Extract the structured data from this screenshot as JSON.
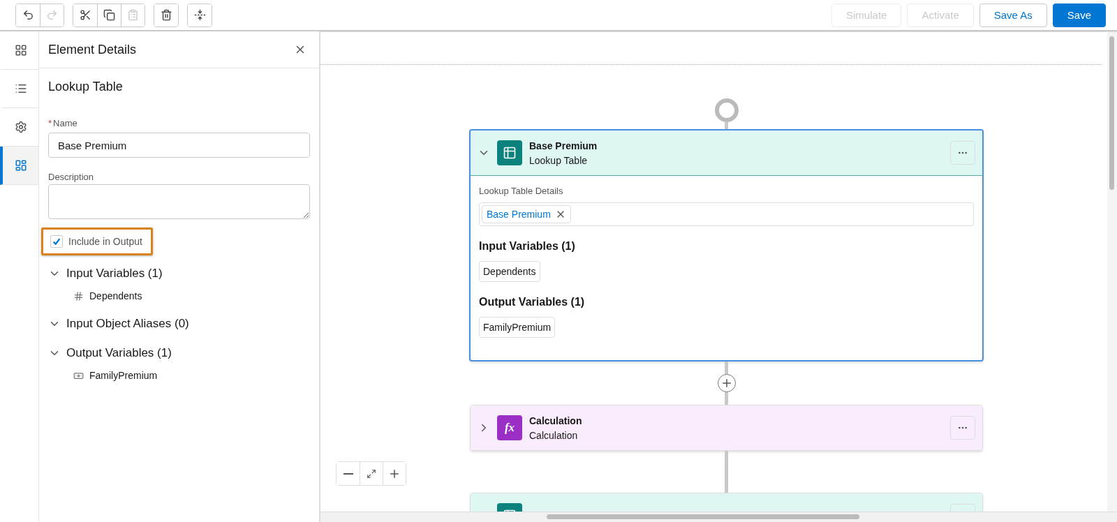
{
  "toolbar": {
    "groups": [
      [
        {
          "kind": "undo",
          "disabled": false
        },
        {
          "kind": "redo",
          "disabled": true
        }
      ],
      [
        {
          "kind": "cut",
          "disabled": false
        },
        {
          "kind": "copy",
          "disabled": false
        },
        {
          "kind": "paste",
          "disabled": true
        }
      ],
      [
        {
          "kind": "delete",
          "disabled": false
        }
      ],
      [
        {
          "kind": "insert",
          "disabled": false
        }
      ]
    ],
    "actions": [
      {
        "label": "Simulate",
        "kind": "neutral",
        "disabled": true
      },
      {
        "label": "Activate",
        "kind": "neutral",
        "disabled": true
      },
      {
        "label": "Save As",
        "kind": "neutral",
        "disabled": false
      },
      {
        "label": "Save",
        "kind": "primary",
        "disabled": false
      }
    ]
  },
  "rail": [
    {
      "kind": "components",
      "selected": false
    },
    {
      "kind": "list",
      "selected": false
    },
    {
      "kind": "settings",
      "selected": false
    },
    {
      "kind": "details",
      "selected": true
    }
  ],
  "panel": {
    "title": "Element Details",
    "heading": "Lookup Table",
    "name_field": {
      "required_mark": "*",
      "label": "Name",
      "value": "Base Premium"
    },
    "description_field": {
      "label": "Description"
    },
    "include_output": {
      "label": "Include in Output",
      "checked": true,
      "highlighted": true
    },
    "sections": [
      {
        "title": "Input Variables (1)",
        "expanded": true,
        "items": [
          {
            "kind": "number",
            "label": "Dependents"
          }
        ]
      },
      {
        "title": "Input Object Aliases (0)",
        "expanded": true
      },
      {
        "title": "Output Variables (1)",
        "expanded": true,
        "items": [
          {
            "kind": "currency",
            "label": "FamilyPremium"
          }
        ]
      }
    ]
  },
  "canvas": {
    "nodes": [
      {
        "kind": "lookup",
        "title": "Base Premium",
        "subtitle": "Lookup Table",
        "expanded": true,
        "selected": true,
        "details_label": "Lookup Table Details",
        "pill": "Base Premium",
        "groups": [
          {
            "title": "Input Variables (1)",
            "chips": [
              "Dependents"
            ]
          },
          {
            "title": "Output Variables (1)",
            "chips": [
              "FamilyPremium"
            ]
          }
        ]
      },
      {
        "kind": "calculation",
        "icon_text": "fx",
        "title": "Calculation",
        "subtitle": "Calculation",
        "expanded": false,
        "selected": false
      },
      {
        "kind": "lookup",
        "selected": false
      }
    ]
  }
}
